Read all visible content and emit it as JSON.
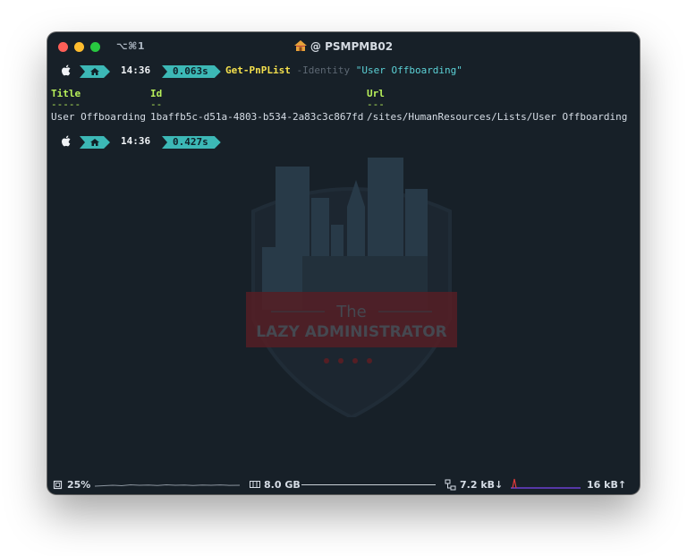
{
  "window": {
    "shortcut": "⌥⌘1",
    "title": "@ PSMPMB02",
    "title_icon": "house-icon"
  },
  "prompt1": {
    "time": "14:36",
    "duration": "0.063s",
    "command": "Get-PnPList",
    "param": "-Identity",
    "arg": "\"User Offboarding\""
  },
  "table": {
    "headers": [
      "Title",
      "Id",
      "Url"
    ],
    "underlines": [
      "-----",
      "--",
      "---"
    ],
    "rows": [
      [
        "User Offboarding",
        "1baffb5c-d51a-4803-b534-2a83c3c867fd",
        "/sites/HumanResources/Lists/User Offboarding"
      ]
    ]
  },
  "prompt2": {
    "time": "14:36",
    "duration": "0.427s"
  },
  "watermark": {
    "line1": "The",
    "line2": "LAZY ADMINISTRATOR"
  },
  "statusbar": {
    "cpu": "25%",
    "memory": "8.0 GB",
    "net_down": "7.2 kB↓",
    "net_up": "16 kB↑"
  },
  "colors": {
    "background": "#172028",
    "accent_teal": "#3cb8b6",
    "command_yellow": "#f4e04d",
    "header_green": "#b8f05a",
    "string_cyan": "#5cd1d6"
  }
}
